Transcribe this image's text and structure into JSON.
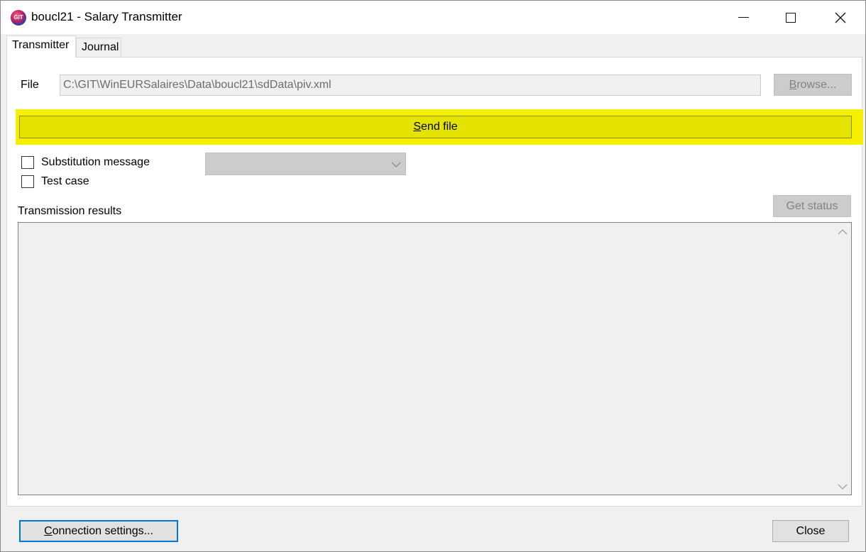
{
  "window": {
    "title": "boucl21 - Salary Transmitter",
    "icon_text": "GIT",
    "minimize_icon": "minimize-icon",
    "maximize_icon": "maximize-icon",
    "close_icon": "close-icon"
  },
  "tabs": [
    {
      "label": "Transmitter",
      "active": true
    },
    {
      "label": "Journal",
      "active": false
    }
  ],
  "transmitter": {
    "file_label": "File",
    "file_path": "C:\\GIT\\WinEURSalaires\\Data\\boucl21\\sdData\\piv.xml",
    "browse_label_pre": "",
    "browse_label_u": "B",
    "browse_label_post": "rowse...",
    "send_label_u": "S",
    "send_label_post": "end file",
    "send_highlight_color": "#f6ef00",
    "substitution_label": "Substitution message",
    "substitution_checked": false,
    "test_case_label": "Test case",
    "test_case_checked": false,
    "substitution_combo_value": "",
    "results_label": "Transmission results",
    "get_status_label": "Get status",
    "results_text": ""
  },
  "footer": {
    "connection_label_u": "C",
    "connection_label_post": "onnection settings...",
    "close_label": "Close"
  }
}
